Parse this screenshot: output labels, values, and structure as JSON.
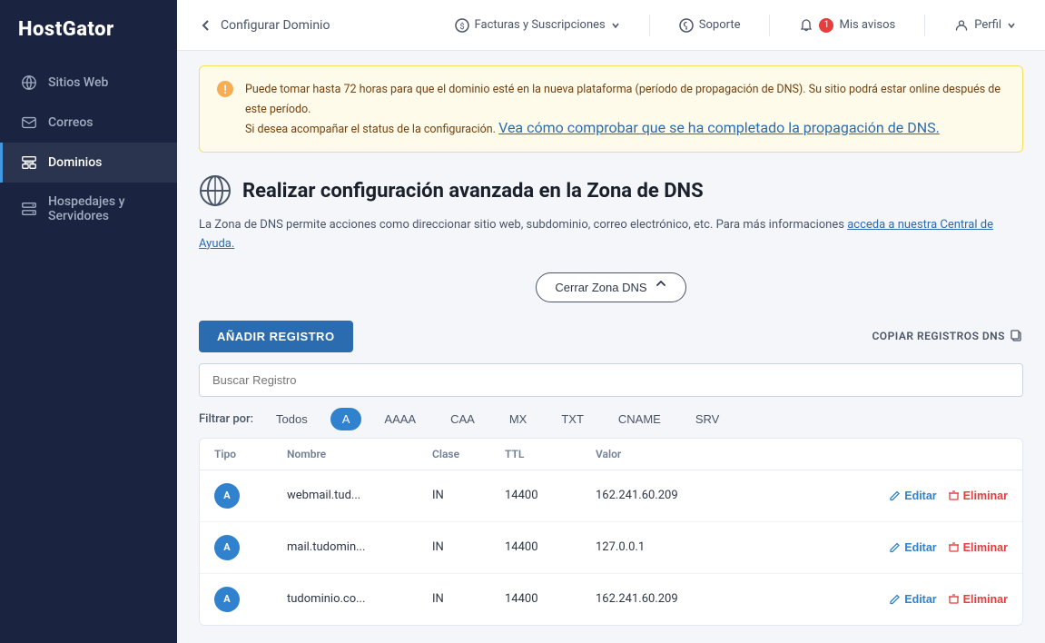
{
  "brand": "HostGator",
  "sidebar": {
    "items": [
      {
        "id": "sitios-web",
        "label": "Sitios Web",
        "icon": "globe"
      },
      {
        "id": "correos",
        "label": "Correos",
        "icon": "mail"
      },
      {
        "id": "dominios",
        "label": "Dominios",
        "icon": "domain",
        "active": true
      },
      {
        "id": "hospedajes",
        "label": "Hospedajes y Servidores",
        "icon": "server"
      }
    ]
  },
  "topbar": {
    "back_label": "Configurar Dominio",
    "nav_items": [
      {
        "id": "facturas",
        "label": "Facturas y Suscripciones",
        "has_dropdown": true,
        "icon": "dollar"
      },
      {
        "id": "soporte",
        "label": "Soporte",
        "icon": "question"
      },
      {
        "id": "avisos",
        "label": "Mis avisos",
        "badge": "1",
        "icon": "bell"
      },
      {
        "id": "perfil",
        "label": "Perfil",
        "has_dropdown": true,
        "icon": "user"
      }
    ]
  },
  "warning": {
    "text": "Puede tomar hasta 72 horas para que el dominio esté en la nueva plataforma (período de propagación de DNS). Su sitio podrá estar online después de este período.",
    "link_text": "Vea cómo comprobar que se ha completado la propagación de DNS.",
    "text2": "Si desea acompañar el status de la configuración. "
  },
  "dns_zone": {
    "title": "Realizar configuración avanzada en la Zona de DNS",
    "description": "La Zona de DNS permite acciones como direccionar sitio web, subdominio, correo electrónico, etc. Para más informaciones",
    "link_text": "acceda a nuestra Central de Ayuda.",
    "close_button": "Cerrar Zona DNS",
    "add_button": "AÑADIR REGISTRO",
    "copy_label": "COPIAR REGISTROS DNS"
  },
  "search": {
    "placeholder": "Buscar Registro"
  },
  "filter": {
    "label": "Filtrar por:",
    "options": [
      "Todos",
      "A",
      "AAAA",
      "CAA",
      "MX",
      "TXT",
      "CNAME",
      "SRV"
    ],
    "active": "A"
  },
  "table": {
    "headers": [
      "Tipo",
      "Nombre",
      "Clase",
      "TTL",
      "Valor",
      ""
    ],
    "rows": [
      {
        "type": "A",
        "name": "webmail.tud...",
        "class": "IN",
        "ttl": "14400",
        "value": "162.241.60.209"
      },
      {
        "type": "A",
        "name": "mail.tudomin...",
        "class": "IN",
        "ttl": "14400",
        "value": "127.0.0.1"
      },
      {
        "type": "A",
        "name": "tudominio.co...",
        "class": "IN",
        "ttl": "14400",
        "value": "162.241.60.209"
      }
    ],
    "edit_label": "Editar",
    "delete_label": "Eliminar"
  }
}
